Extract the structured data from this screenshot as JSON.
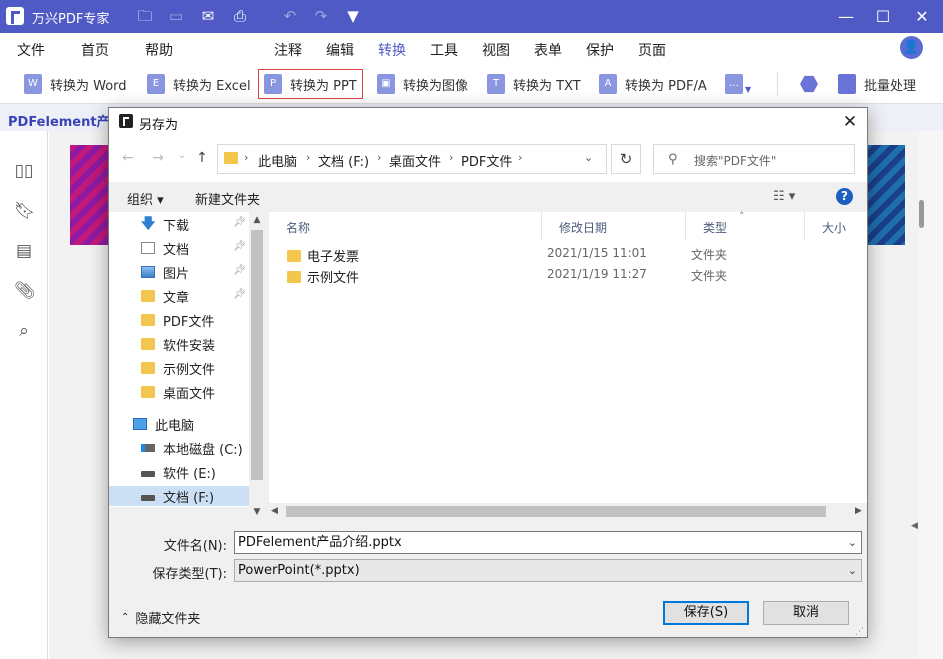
{
  "app": {
    "title": "万兴PDF专家"
  },
  "window_controls": {
    "minimize": "—",
    "maximize": "☐",
    "close": "✕"
  },
  "menu": [
    "文件",
    "首页",
    "帮助",
    "注释",
    "编辑",
    "转换",
    "工具",
    "视图",
    "表单",
    "保护",
    "页面"
  ],
  "menu_active": "转换",
  "user": {
    "avatar_icon": "person-icon"
  },
  "toolbar": {
    "items": [
      {
        "label": "转换为 Word",
        "icon": "W"
      },
      {
        "label": "转换为 Excel",
        "icon": "E"
      },
      {
        "label": "转换为 PPT",
        "icon": "P"
      },
      {
        "label": "转换为图像",
        "icon": "▣"
      },
      {
        "label": "转换为 TXT",
        "icon": "T"
      },
      {
        "label": "转换为 PDF/A",
        "icon": "A"
      }
    ],
    "more_icon": "…",
    "batch_label": "批量处理",
    "selected": "转换为 PPT"
  },
  "document_tab": "PDFelement产品",
  "dialog": {
    "title": "另存为",
    "address": [
      "此电脑",
      "文档 (F:)",
      "桌面文件",
      "PDF文件"
    ],
    "search_placeholder": "搜索\"PDF文件\"",
    "organize_label": "组织 ▾",
    "new_folder_label": "新建文件夹",
    "nav_items": [
      {
        "label": "下载",
        "icon": "download",
        "pinned": true
      },
      {
        "label": "文档",
        "icon": "doc",
        "pinned": true
      },
      {
        "label": "图片",
        "icon": "pic",
        "pinned": true
      },
      {
        "label": "文章",
        "icon": "folder",
        "pinned": true
      },
      {
        "label": "PDF文件",
        "icon": "folder",
        "pinned": false
      },
      {
        "label": "软件安装",
        "icon": "folder",
        "pinned": false
      },
      {
        "label": "示例文件",
        "icon": "folder",
        "pinned": false
      },
      {
        "label": "桌面文件",
        "icon": "folder",
        "pinned": false
      },
      {
        "label": "此电脑",
        "icon": "pc",
        "pinned": false
      },
      {
        "label": "本地磁盘 (C:)",
        "icon": "cdrive",
        "pinned": false
      },
      {
        "label": "软件 (E:)",
        "icon": "drive",
        "pinned": false
      },
      {
        "label": "文档 (F:)",
        "icon": "drive",
        "pinned": false
      }
    ],
    "nav_selected": "文档 (F:)",
    "columns": [
      "名称",
      "修改日期",
      "类型",
      "大小"
    ],
    "files": [
      {
        "name": "电子发票",
        "date": "2021/1/15 11:01",
        "type": "文件夹"
      },
      {
        "name": "示例文件",
        "date": "2021/1/19 11:27",
        "type": "文件夹"
      }
    ],
    "filename_label": "文件名(N):",
    "filename_value": "PDFelement产品介绍.pptx",
    "filetype_label": "保存类型(T):",
    "filetype_value": "PowerPoint(*.pptx)",
    "hide_folders_label": "隐藏文件夹",
    "save_label": "保存(S)",
    "cancel_label": "取消"
  }
}
